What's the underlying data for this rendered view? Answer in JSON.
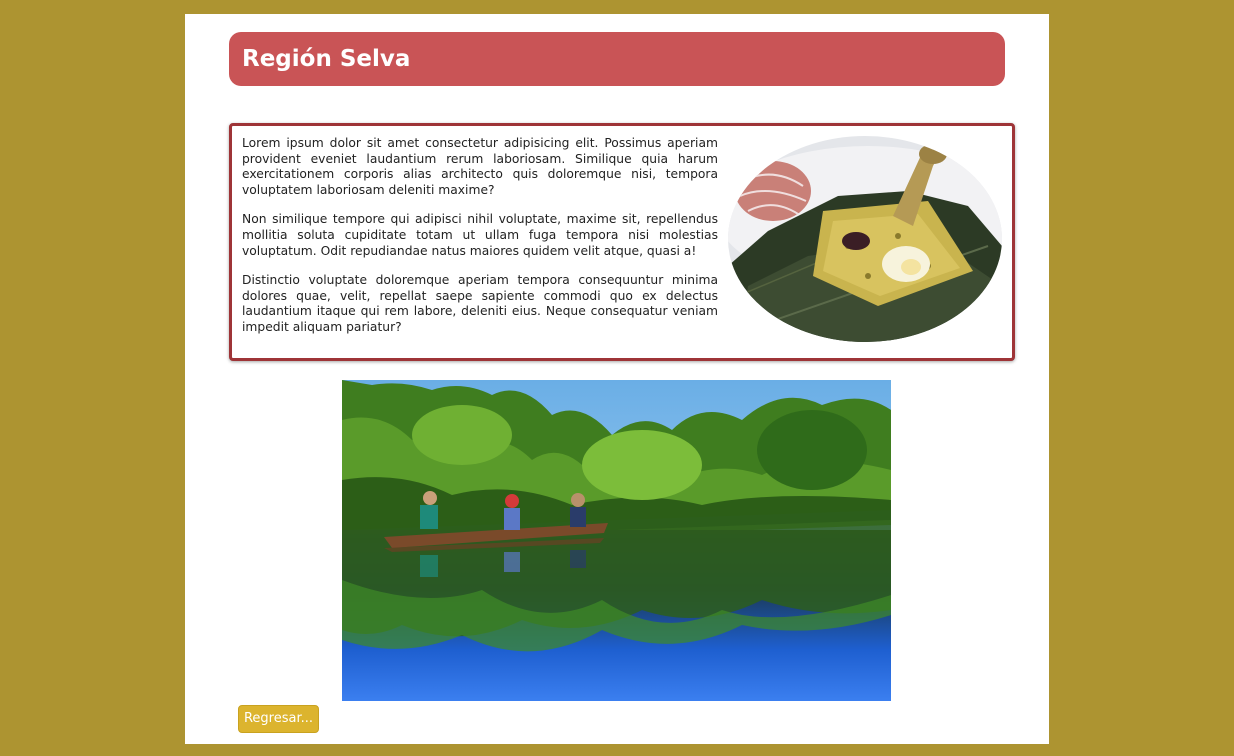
{
  "page": {
    "title": "Región Selva",
    "paragraphs": [
      "Lorem ipsum dolor sit amet consectetur adipisicing elit. Possimus aperiam provident eveniet laudantium rerum laboriosam. Similique quia harum exercitationem corporis alias architecto quis doloremque nisi, tempora voluptatem laboriosam deleniti maxime?",
      "Non similique tempore qui adipisci nihil voluptate, maxime sit, repellendus mollitia soluta cupiditate totam ut ullam fuga tempora nisi molestias voluptatum. Odit repudiandae natus maiores quidem velit atque, quasi a!",
      "Distinctio voluptate doloremque aperiam tempora consequuntur minima dolores quae, velit, repellat saepe sapiente commodi quo ex delectus laudantium itaque qui rem labore, deleniti eius. Neque consequatur veniam impedit aliquam pariatur?"
    ],
    "back_button_label": "Regresar..."
  },
  "colors": {
    "background": "#ad9431",
    "title_bar": "#c95456",
    "box_border": "#9e3437",
    "button": "#dcb42e"
  }
}
